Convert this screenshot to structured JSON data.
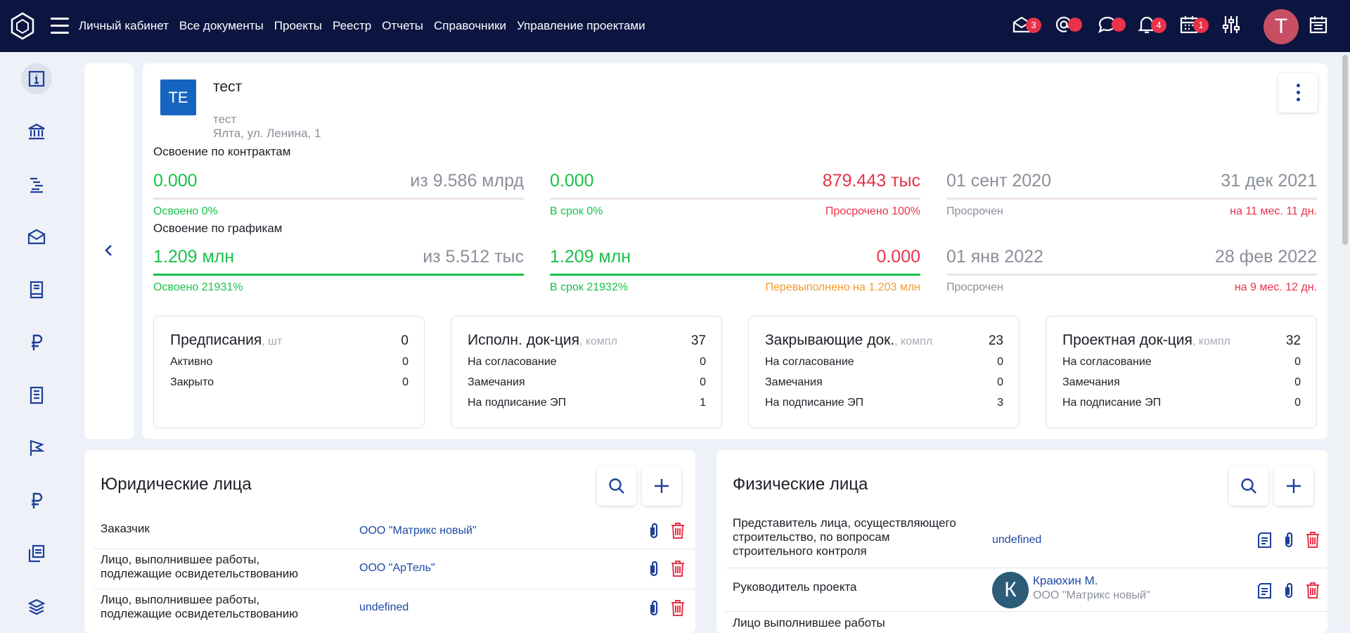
{
  "nav": {
    "items": [
      "Личный кабинет",
      "Все документы",
      "Проекты",
      "Реестр",
      "Отчеты",
      "Справочники",
      "Управление проектами"
    ],
    "badges": {
      "mail": "3",
      "mentions": "",
      "chat": "",
      "bell": "4",
      "calendar": "1"
    },
    "avatar_letter": "Т"
  },
  "project": {
    "avatar": "ТЕ",
    "title": "тест",
    "subtitle": "тест",
    "address": "Ялта, ул. Ленина, 1"
  },
  "contracts": {
    "heading": "Освоение по контрактам",
    "mastered": {
      "left": "0.000",
      "right": "из 9.586 млрд",
      "sub_left": "Освоено 0%",
      "sub_right": "",
      "fill": 0
    },
    "ontime": {
      "left": "0.000",
      "right": "879.443 тыс",
      "sub_left": "В срок 0%",
      "sub_right": "Просрочено 100%",
      "fill": 0
    },
    "dates": {
      "left": "01 сент 2020",
      "right": "31 дек 2021",
      "sub_left": "Просрочен",
      "sub_right": "на 11 мес. 11 дн.",
      "fill": 0
    }
  },
  "schedules": {
    "heading": "Освоение по графикам",
    "mastered": {
      "left": "1.209 млн",
      "right": "из 5.512 тыс",
      "sub_left": "Освоено 21931%",
      "sub_right": "",
      "fill": 1
    },
    "ontime": {
      "left": "1.209 млн",
      "right": "0.000",
      "sub_left": "В срок 21932%",
      "sub_right": "Перевыполнено на 1.203 млн",
      "fill": 1
    },
    "dates": {
      "left": "01 янв 2022",
      "right": "28 фев 2022",
      "sub_left": "Просрочен",
      "sub_right": "на 9 мес. 12 дн.",
      "fill": 0
    }
  },
  "stats": [
    {
      "title": "Предписания",
      "unit": ", шт",
      "total": "0",
      "rows": [
        {
          "label": "Активно",
          "value": "0"
        },
        {
          "label": "Закрыто",
          "value": "0"
        }
      ]
    },
    {
      "title": "Исполн. док-ция",
      "unit": ", компл",
      "total": "37",
      "rows": [
        {
          "label": "На согласование",
          "value": "0"
        },
        {
          "label": "Замечания",
          "value": "0"
        },
        {
          "label": "На подписание ЭП",
          "value": "1"
        }
      ]
    },
    {
      "title": "Закрывающие док.",
      "unit": ", компл",
      "total": "23",
      "rows": [
        {
          "label": "На согласование",
          "value": "0"
        },
        {
          "label": "Замечания",
          "value": "0"
        },
        {
          "label": "На подписание ЭП",
          "value": "3"
        }
      ]
    },
    {
      "title": "Проектная док-ция",
      "unit": ", компл",
      "total": "32",
      "rows": [
        {
          "label": "На согласование",
          "value": "0"
        },
        {
          "label": "Замечания",
          "value": "0"
        },
        {
          "label": "На подписание ЭП",
          "value": "0"
        }
      ]
    }
  ],
  "legal": {
    "title": "Юридические лица",
    "rows": [
      {
        "label": "Заказчик",
        "value": "ООО \"Матрикс новый\""
      },
      {
        "label": "Лицо, выполнившее работы, подлежащие освидетельствованию",
        "value": "ООО \"АрТель\""
      },
      {
        "label": "Лицо, выполнившее работы, подлежащие освидетельствованию",
        "value": "undefined"
      }
    ]
  },
  "physical": {
    "title": "Физические лица",
    "rows": [
      {
        "label": "Представитель лица, осуществляющего строительство, по вопросам строительного контроля",
        "value": "undefined"
      },
      {
        "label": "Руководитель проекта",
        "person": "Краюхин М.",
        "org": "ООО \"Матрикс новый\"",
        "avatar": "К"
      },
      {
        "label": "Лицо выполнившее работы",
        "value": ""
      }
    ]
  },
  "colors": {
    "topbar": "#0c1540",
    "accent": "#1d3f9a",
    "green": "#19c24a",
    "red": "#e8334a",
    "orange": "#f39a2b"
  }
}
